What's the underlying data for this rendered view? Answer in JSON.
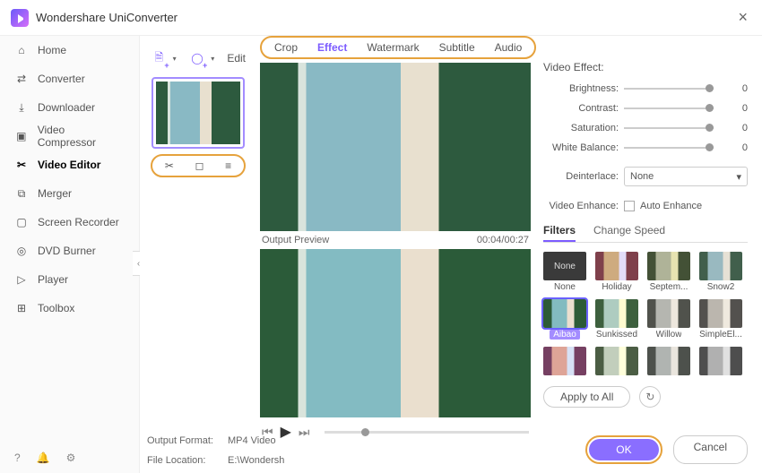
{
  "app": {
    "title": "Wondershare UniConverter"
  },
  "sidebar": {
    "items": [
      {
        "label": "Home",
        "icon": "home-icon"
      },
      {
        "label": "Converter",
        "icon": "converter-icon"
      },
      {
        "label": "Downloader",
        "icon": "downloader-icon"
      },
      {
        "label": "Video Compressor",
        "icon": "compressor-icon"
      },
      {
        "label": "Video Editor",
        "icon": "editor-icon",
        "active": true
      },
      {
        "label": "Merger",
        "icon": "merger-icon"
      },
      {
        "label": "Screen Recorder",
        "icon": "recorder-icon"
      },
      {
        "label": "DVD Burner",
        "icon": "dvd-icon"
      },
      {
        "label": "Player",
        "icon": "player-icon"
      },
      {
        "label": "Toolbox",
        "icon": "toolbox-icon"
      }
    ]
  },
  "workspace": {
    "edit_label": "Edit",
    "output_format_label": "Output Format:",
    "output_format_value": "MP4 Video",
    "file_location_label": "File Location:",
    "file_location_value": "E:\\Wondersh"
  },
  "tabs": {
    "items": [
      "Crop",
      "Effect",
      "Watermark",
      "Subtitle",
      "Audio"
    ],
    "active": "Effect"
  },
  "preview": {
    "label": "Output Preview",
    "time": "00:04/00:27"
  },
  "video_effect": {
    "title": "Video Effect:",
    "sliders": [
      {
        "label": "Brightness:",
        "value": 0
      },
      {
        "label": "Contrast:",
        "value": 0
      },
      {
        "label": "Saturation:",
        "value": 0
      },
      {
        "label": "White Balance:",
        "value": 0
      }
    ],
    "deinterlace_label": "Deinterlace:",
    "deinterlace_value": "None",
    "enhance_label": "Video Enhance:",
    "auto_enhance_label": "Auto Enhance"
  },
  "subtabs": {
    "items": [
      "Filters",
      "Change Speed"
    ],
    "active": "Filters"
  },
  "filters": {
    "items": [
      {
        "name": "None",
        "class": "none"
      },
      {
        "name": "Holiday",
        "class": "holiday"
      },
      {
        "name": "Septem...",
        "class": "septem"
      },
      {
        "name": "Snow2",
        "class": "snow2"
      },
      {
        "name": "Aibao",
        "class": "aibao",
        "selected": true
      },
      {
        "name": "Sunkissed",
        "class": "sunkissed"
      },
      {
        "name": "Willow",
        "class": "willow"
      },
      {
        "name": "SimpleEl...",
        "class": "simpleel"
      }
    ],
    "none_thumb_text": "None",
    "apply_all": "Apply to All"
  },
  "dialog": {
    "ok": "OK",
    "cancel": "Cancel"
  }
}
